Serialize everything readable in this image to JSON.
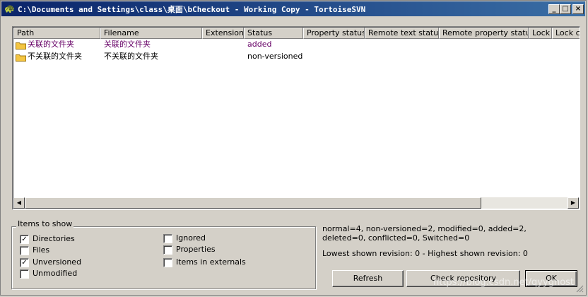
{
  "window": {
    "title": "C:\\Documents and Settings\\class\\桌面\\bCheckout - Working Copy - TortoiseSVN",
    "icon": "tortoise-icon"
  },
  "list": {
    "columns": [
      "Path",
      "Filename",
      "Extension",
      "Status",
      "Property status",
      "Remote text status",
      "Remote property status",
      "Lock",
      "Lock co"
    ],
    "rows": [
      {
        "path": "关联的文件夹",
        "filename": "关联的文件夹",
        "extension": "",
        "status": "added"
      },
      {
        "path": "不关联的文件夹",
        "filename": "不关联的文件夹",
        "extension": "",
        "status": "non-versioned"
      }
    ]
  },
  "items_to_show": {
    "title": "Items to show",
    "options": [
      {
        "label": "Directories",
        "checked": true
      },
      {
        "label": "Files",
        "checked": false
      },
      {
        "label": "Unversioned",
        "checked": true
      },
      {
        "label": "Unmodified",
        "checked": false
      },
      {
        "label": "Ignored",
        "checked": false
      },
      {
        "label": "Properties",
        "checked": false
      },
      {
        "label": "Items in externals",
        "checked": false
      }
    ]
  },
  "stats": {
    "summary": "normal=4, non-versioned=2, modified=0, added=2, deleted=0, conflicted=0, Switched=0",
    "revision": "Lowest shown revision: 0 - Highest shown revision: 0"
  },
  "buttons": {
    "refresh": "Refresh",
    "check_repository": "Check repository",
    "ok": "OK"
  },
  "watermark": "https://blog.csdn.net/qyyghost",
  "colors": {
    "title_start": "#0a246a",
    "title_end": "#3a6ea5",
    "added": "#660066",
    "folder": "#f4c542"
  }
}
